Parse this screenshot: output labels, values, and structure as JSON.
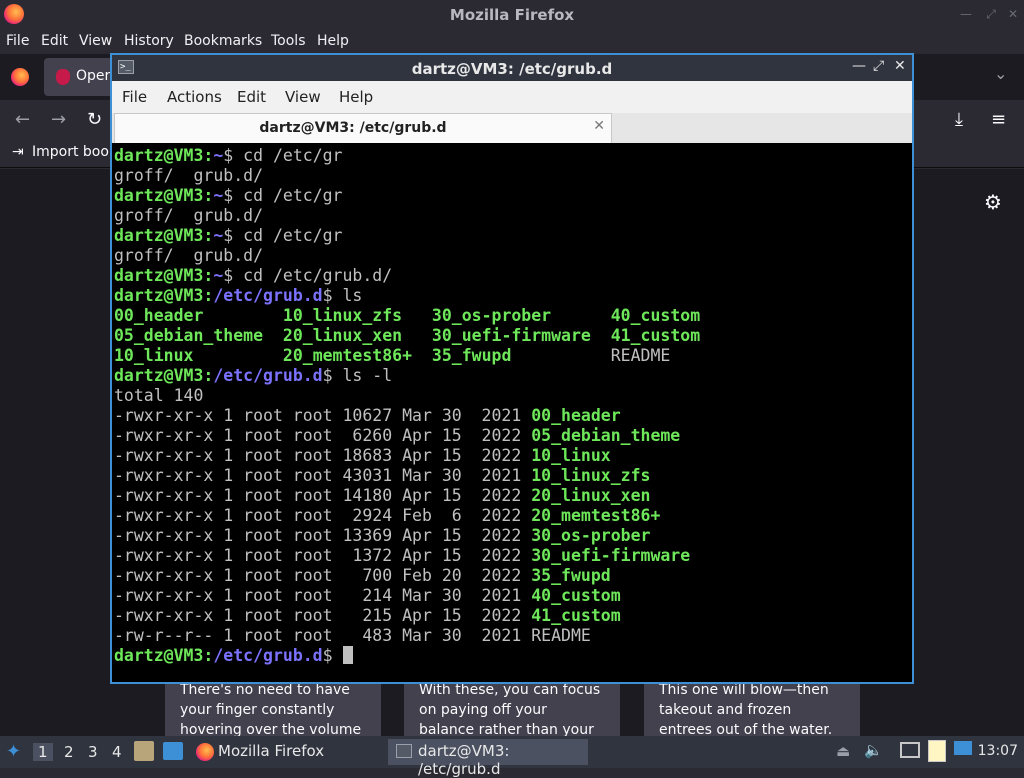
{
  "firefox": {
    "title": "Mozilla Firefox",
    "menu": [
      "File",
      "Edit",
      "View",
      "History",
      "Bookmarks",
      "Tools",
      "Help"
    ],
    "tab_label": "Oper",
    "import_bookmarks": "Import book",
    "cards": [
      "There's no need to have your finger constantly hovering over the volume buttons.",
      "With these, you can focus on paying off your balance rather than your interest.",
      "This one will blow—then takeout and frozen entrees out of the water."
    ]
  },
  "terminal": {
    "title": "dartz@VM3: /etc/grub.d",
    "menu": [
      "File",
      "Actions",
      "Edit",
      "View",
      "Help"
    ],
    "tab_label": "dartz@VM3: /etc/grub.d",
    "lines": [
      {
        "prompt_user": "dartz@VM3",
        "prompt_path": "~",
        "cmd": "cd /etc/gr"
      },
      {
        "out": "groff/  grub.d/"
      },
      {
        "prompt_user": "dartz@VM3",
        "prompt_path": "~",
        "cmd": "cd /etc/gr"
      },
      {
        "out": "groff/  grub.d/"
      },
      {
        "prompt_user": "dartz@VM3",
        "prompt_path": "~",
        "cmd": "cd /etc/gr"
      },
      {
        "out": "groff/  grub.d/"
      },
      {
        "prompt_user": "dartz@VM3",
        "prompt_path": "~",
        "cmd": "cd /etc/grub.d/"
      },
      {
        "prompt_user": "dartz@VM3",
        "prompt_path": "/etc/grub.d",
        "cmd": "ls"
      },
      {
        "cols": [
          {
            "t": "00_header        ",
            "x": true
          },
          {
            "t": "10_linux_zfs   ",
            "x": true
          },
          {
            "t": "30_os-prober      ",
            "x": true
          },
          {
            "t": "40_custom",
            "x": true
          }
        ]
      },
      {
        "cols": [
          {
            "t": "05_debian_theme  ",
            "x": true
          },
          {
            "t": "20_linux_xen   ",
            "x": true
          },
          {
            "t": "30_uefi-firmware  ",
            "x": true
          },
          {
            "t": "41_custom",
            "x": true
          }
        ]
      },
      {
        "cols": [
          {
            "t": "10_linux         ",
            "x": true
          },
          {
            "t": "20_memtest86+  ",
            "x": true
          },
          {
            "t": "35_fwupd          ",
            "x": true
          },
          {
            "t": "README",
            "x": false
          }
        ]
      },
      {
        "prompt_user": "dartz@VM3",
        "prompt_path": "/etc/grub.d",
        "cmd": "ls -l"
      },
      {
        "out": "total 140"
      },
      {
        "perm": "-rwxr-xr-x 1 root root 10627 Mar 30  2021 ",
        "name": "00_header",
        "x": true
      },
      {
        "perm": "-rwxr-xr-x 1 root root  6260 Apr 15  2022 ",
        "name": "05_debian_theme",
        "x": true
      },
      {
        "perm": "-rwxr-xr-x 1 root root 18683 Apr 15  2022 ",
        "name": "10_linux",
        "x": true
      },
      {
        "perm": "-rwxr-xr-x 1 root root 43031 Mar 30  2021 ",
        "name": "10_linux_zfs",
        "x": true
      },
      {
        "perm": "-rwxr-xr-x 1 root root 14180 Apr 15  2022 ",
        "name": "20_linux_xen",
        "x": true
      },
      {
        "perm": "-rwxr-xr-x 1 root root  2924 Feb  6  2022 ",
        "name": "20_memtest86+",
        "x": true
      },
      {
        "perm": "-rwxr-xr-x 1 root root 13369 Apr 15  2022 ",
        "name": "30_os-prober",
        "x": true
      },
      {
        "perm": "-rwxr-xr-x 1 root root  1372 Apr 15  2022 ",
        "name": "30_uefi-firmware",
        "x": true
      },
      {
        "perm": "-rwxr-xr-x 1 root root   700 Feb 20  2022 ",
        "name": "35_fwupd",
        "x": true
      },
      {
        "perm": "-rwxr-xr-x 1 root root   214 Mar 30  2021 ",
        "name": "40_custom",
        "x": true
      },
      {
        "perm": "-rwxr-xr-x 1 root root   215 Apr 15  2022 ",
        "name": "41_custom",
        "x": true
      },
      {
        "perm": "-rw-r--r-- 1 root root   483 Mar 30  2021 ",
        "name": "README",
        "x": false
      },
      {
        "prompt_user": "dartz@VM3",
        "prompt_path": "/etc/grub.d",
        "cmd": "",
        "cursor": true
      }
    ]
  },
  "taskbar": {
    "workspaces": [
      "1",
      "2",
      "3",
      "4"
    ],
    "firefox_label": "Mozilla Firefox",
    "terminal_label": "dartz@VM3: /etc/grub.d",
    "clock": "13:07"
  },
  "colors": {
    "prompt_green": "#6ee85a",
    "path_blue": "#7b73ff",
    "window_border": "#3d8fd6"
  }
}
